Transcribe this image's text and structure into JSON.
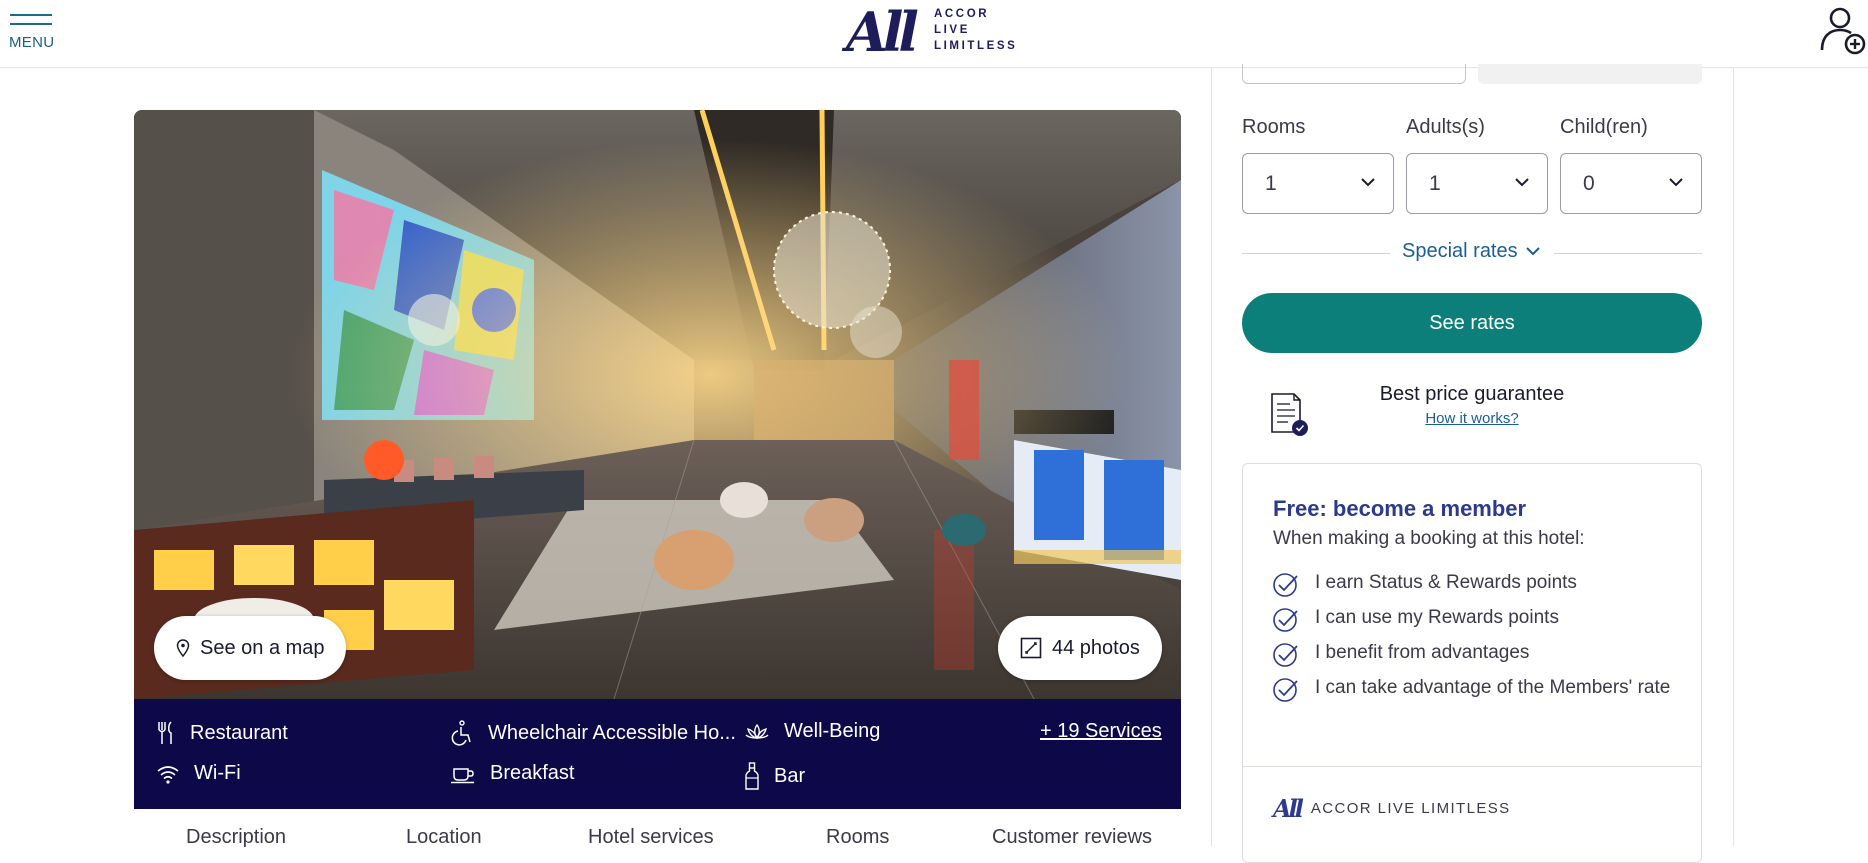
{
  "header": {
    "menu_label": "MENU",
    "logo_lines": [
      "ACCOR",
      "LIVE",
      "LIMITLESS"
    ],
    "logo_mark": "All"
  },
  "hero": {
    "map_button": "See on a map",
    "photos_button": "44 photos"
  },
  "services": {
    "items": [
      {
        "label": "Restaurant",
        "icon": "fork-knife-icon"
      },
      {
        "label": "Wheelchair Accessible Ho...",
        "icon": "wheelchair-icon"
      },
      {
        "label": "Well-Being",
        "icon": "lotus-icon"
      },
      {
        "label": "Wi-Fi",
        "icon": "wifi-icon"
      },
      {
        "label": "Breakfast",
        "icon": "coffee-cup-icon"
      },
      {
        "label": "Bar",
        "icon": "bottle-icon"
      }
    ],
    "more_link": "+ 19 Services",
    "bar_color": "#0d0847"
  },
  "tabs": [
    "Description",
    "Location",
    "Hotel services",
    "Rooms",
    "Customer reviews"
  ],
  "booking": {
    "rooms_label": "Rooms",
    "rooms_value": "1",
    "adults_label": "Adults(s)",
    "adults_value": "1",
    "children_label": "Child(ren)",
    "children_value": "0",
    "special_rates": "Special rates",
    "see_rates": "See rates",
    "accent_color": "#0d7f7a"
  },
  "price_guarantee": {
    "title": "Best price guarantee",
    "link": "How it works?"
  },
  "member": {
    "title": "Free: become a member",
    "subtitle": "When making a booking at this hotel:",
    "benefits": [
      "I earn Status & Rewards points",
      "I can use my Rewards points",
      "I benefit from advantages",
      "I can take advantage of the Members' rate"
    ],
    "footer_mark": "All",
    "footer_text": "ACCOR LIVE LIMITLESS"
  }
}
